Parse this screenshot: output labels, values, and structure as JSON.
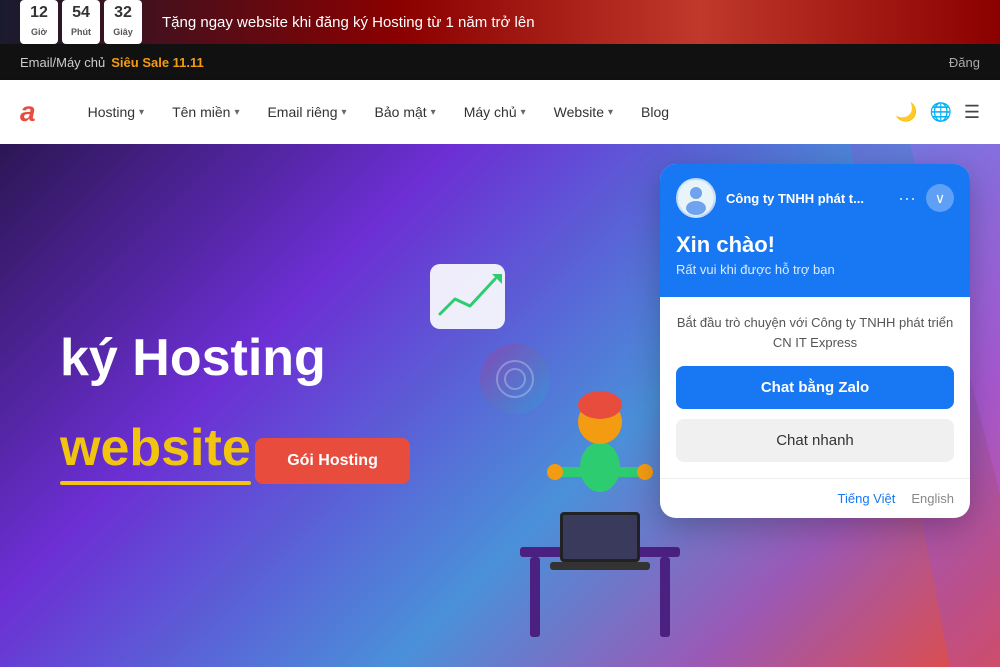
{
  "countdown_banner": {
    "hours_label": "Giờ",
    "minutes_label": "Phút",
    "seconds_label": "Giây",
    "hours_value": "12",
    "minutes_value": "54",
    "seconds_value": "32",
    "banner_text": "Tặng ngay website khi đăng ký Hosting từ 1 năm trở lên"
  },
  "sale_bar": {
    "prefix_text": "Email/Máy chủ",
    "sale_link_text": "Siêu Sale 11.11",
    "right_text": "Đăng"
  },
  "navbar": {
    "logo": "a",
    "nav_items": [
      {
        "label": "Hosting",
        "has_dropdown": true
      },
      {
        "label": "Tên miền",
        "has_dropdown": true
      },
      {
        "label": "Email riêng",
        "has_dropdown": true
      },
      {
        "label": "Bảo mật",
        "has_dropdown": true
      },
      {
        "label": "Máy chủ",
        "has_dropdown": true
      },
      {
        "label": "Website",
        "has_dropdown": true
      },
      {
        "label": "Blog",
        "has_dropdown": false
      }
    ]
  },
  "hero": {
    "title_line1": "ký Hosting",
    "title_line2": "website",
    "cta_label": "Gói Hosting"
  },
  "chat_widget": {
    "company_name": "Công ty TNHH phát t...",
    "greeting_title": "Xin chào!",
    "greeting_sub": "Rất vui khi được hỗ trợ bạn",
    "prompt_text": "Bắt đầu trò chuyện với Công ty TNHH phát triển CN IT Express",
    "btn_zalo_label": "Chat bằng Zalo",
    "btn_quick_label": "Chat nhanh",
    "lang_vi": "Tiếng Việt",
    "lang_en": "English"
  }
}
